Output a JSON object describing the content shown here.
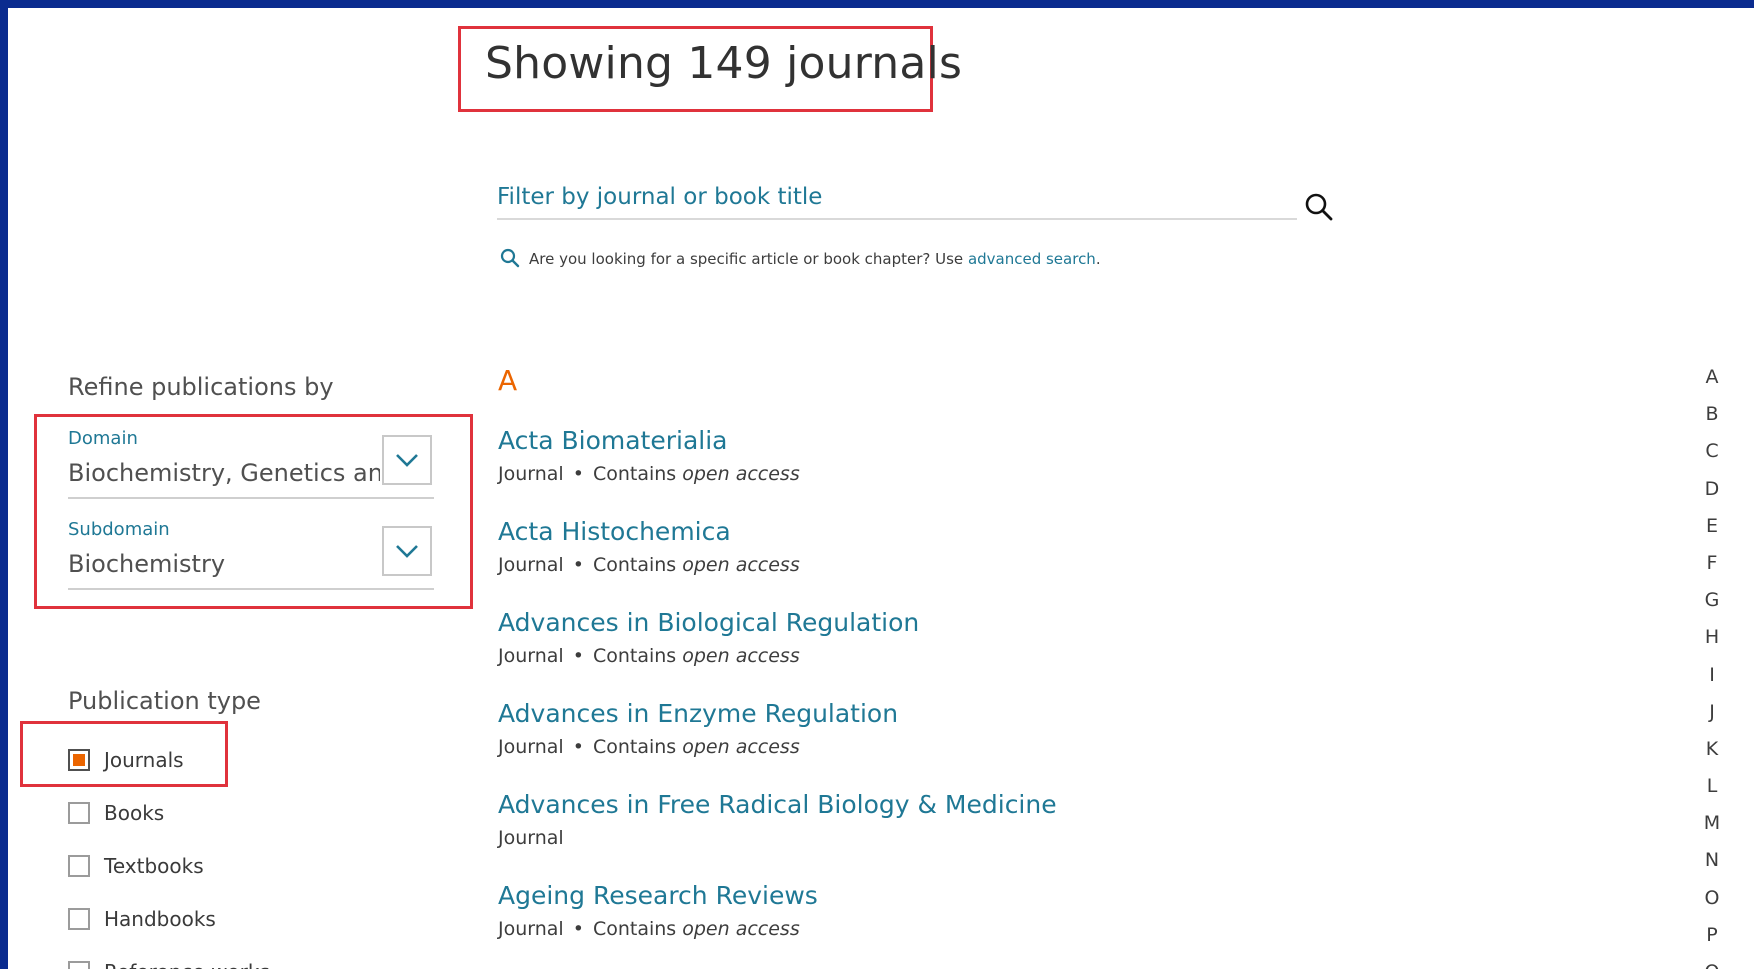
{
  "header": {
    "title": "Showing 149 journals"
  },
  "search": {
    "placeholder": "Filter by journal or book title",
    "hint_prefix": "Are you looking for a specific article or book chapter? Use",
    "hint_link": "advanced search",
    "hint_suffix": "."
  },
  "refine": {
    "title": "Refine publications by",
    "domain_label": "Domain",
    "domain_value": "Biochemistry, Genetics and Molecular Biology",
    "subdomain_label": "Subdomain",
    "subdomain_value": "Biochemistry"
  },
  "publication_type": {
    "title": "Publication type",
    "options": [
      {
        "label": "Journals",
        "checked": true
      },
      {
        "label": "Books",
        "checked": false
      },
      {
        "label": "Textbooks",
        "checked": false
      },
      {
        "label": "Handbooks",
        "checked": false
      },
      {
        "label": "Reference works",
        "checked": false
      }
    ]
  },
  "list": {
    "letter": "A",
    "items": [
      {
        "title": "Acta Biomaterialia",
        "type": "Journal",
        "access_prefix": "Contains",
        "access": "open access"
      },
      {
        "title": "Acta Histochemica",
        "type": "Journal",
        "access_prefix": "Contains",
        "access": "open access"
      },
      {
        "title": "Advances in Biological Regulation",
        "type": "Journal",
        "access_prefix": "Contains",
        "access": "open access"
      },
      {
        "title": "Advances in Enzyme Regulation",
        "type": "Journal",
        "access_prefix": "Contains",
        "access": "open access"
      },
      {
        "title": "Advances in Free Radical Biology & Medicine",
        "type": "Journal",
        "access_prefix": "",
        "access": ""
      },
      {
        "title": "Ageing Research Reviews",
        "type": "Journal",
        "access_prefix": "Contains",
        "access": "open access"
      }
    ]
  },
  "alphabet": [
    "A",
    "B",
    "C",
    "D",
    "E",
    "F",
    "G",
    "H",
    "I",
    "J",
    "K",
    "L",
    "M",
    "N",
    "O",
    "P",
    "Q"
  ],
  "colors": {
    "link": "#1f7895",
    "accent": "#eb6500",
    "highlight": "#e0323c",
    "frame": "#0a2b8f"
  }
}
